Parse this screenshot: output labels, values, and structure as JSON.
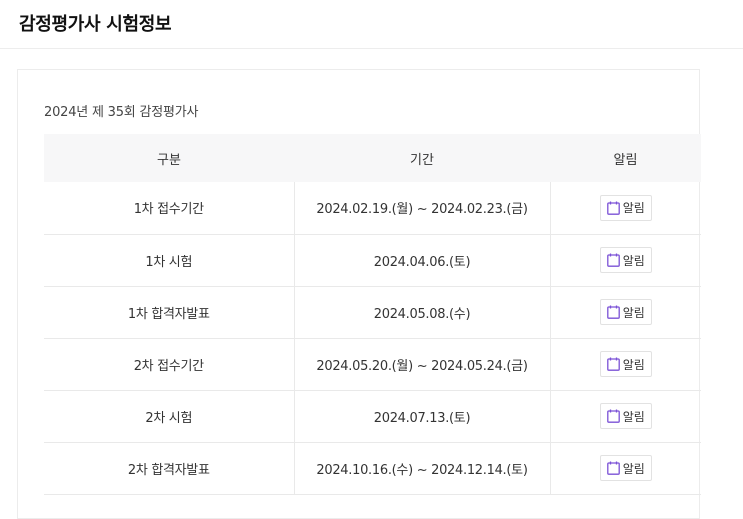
{
  "page": {
    "title": "감정평가사 시험정보"
  },
  "exam": {
    "title": "2024년 제 35회 감정평가사"
  },
  "table": {
    "headers": [
      "구분",
      "기간",
      "알림"
    ],
    "rows": [
      {
        "category": "1차 접수기간",
        "period": "2024.02.19.(월) ~ 2024.02.23.(금)",
        "alarm": "알림"
      },
      {
        "category": "1차 시험",
        "period": "2024.04.06.(토)",
        "alarm": "알림"
      },
      {
        "category": "1차 합격자발표",
        "period": "2024.05.08.(수)",
        "alarm": "알림"
      },
      {
        "category": "2차 접수기간",
        "period": "2024.05.20.(월) ~ 2024.05.24.(금)",
        "alarm": "알림"
      },
      {
        "category": "2차 시험",
        "period": "2024.07.13.(토)",
        "alarm": "알림"
      },
      {
        "category": "2차 합격자발표",
        "period": "2024.10.16.(수) ~ 2024.12.14.(토)",
        "alarm": "알림"
      }
    ]
  },
  "icons": {
    "alarm": "calendar-icon"
  },
  "colors": {
    "icon_purple": "#7b52d6",
    "header_bg": "#f7f7f8",
    "border": "#e9e9e9"
  }
}
